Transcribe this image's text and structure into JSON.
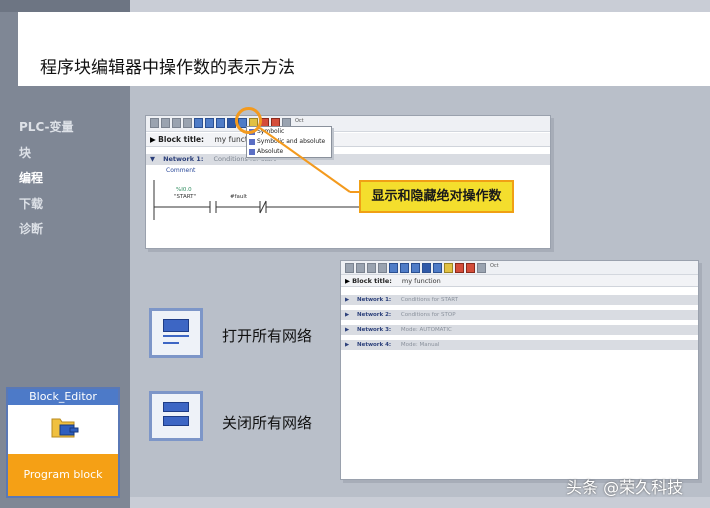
{
  "page": {
    "title": "程序块编辑器中操作数的表示方法"
  },
  "sidebar": {
    "items": [
      {
        "label": "PLC-变量"
      },
      {
        "label": "块"
      },
      {
        "label": "编程",
        "active": true
      },
      {
        "label": "下载"
      },
      {
        "label": "诊断"
      }
    ]
  },
  "editor1": {
    "block_title_label": "Block title:",
    "block_title_value": "my function",
    "network_label": "Network 1:",
    "network_comment": "Conditions for start",
    "comment_label": "Comment",
    "contact1_addr": "%I0.0",
    "contact1_name": "\"START\"",
    "contact2_name": "#fault",
    "view_menu": {
      "items": [
        "Symbolic",
        "Symbolic and absolute",
        "Absolute"
      ]
    },
    "toolbar_extra": "Oct"
  },
  "callout": {
    "text": "显示和隐藏绝对操作数"
  },
  "editor2": {
    "block_title_label": "Block title:",
    "block_title_value": "my function",
    "networks": [
      {
        "label": "Network 1:",
        "comment": "Conditions for START"
      },
      {
        "label": "Network 2:",
        "comment": "Conditions for STOP"
      },
      {
        "label": "Network 3:",
        "comment": "Mode: AUTOMATIC"
      },
      {
        "label": "Network 4:",
        "comment": "Mode: Manual"
      }
    ],
    "toolbar_extra": "Oct"
  },
  "actions": {
    "open_all_label": "打开所有网络",
    "close_all_label": "关闭所有网络"
  },
  "block_editor_card": {
    "title": "Block_Editor",
    "footer": "Program block"
  },
  "watermark": "头条 @荣久科技",
  "colors": {
    "accent": "#f39a1e",
    "callout_bg": "#f4de2d",
    "brand_blue": "#4d7ac8",
    "orange": "#f5a015"
  }
}
